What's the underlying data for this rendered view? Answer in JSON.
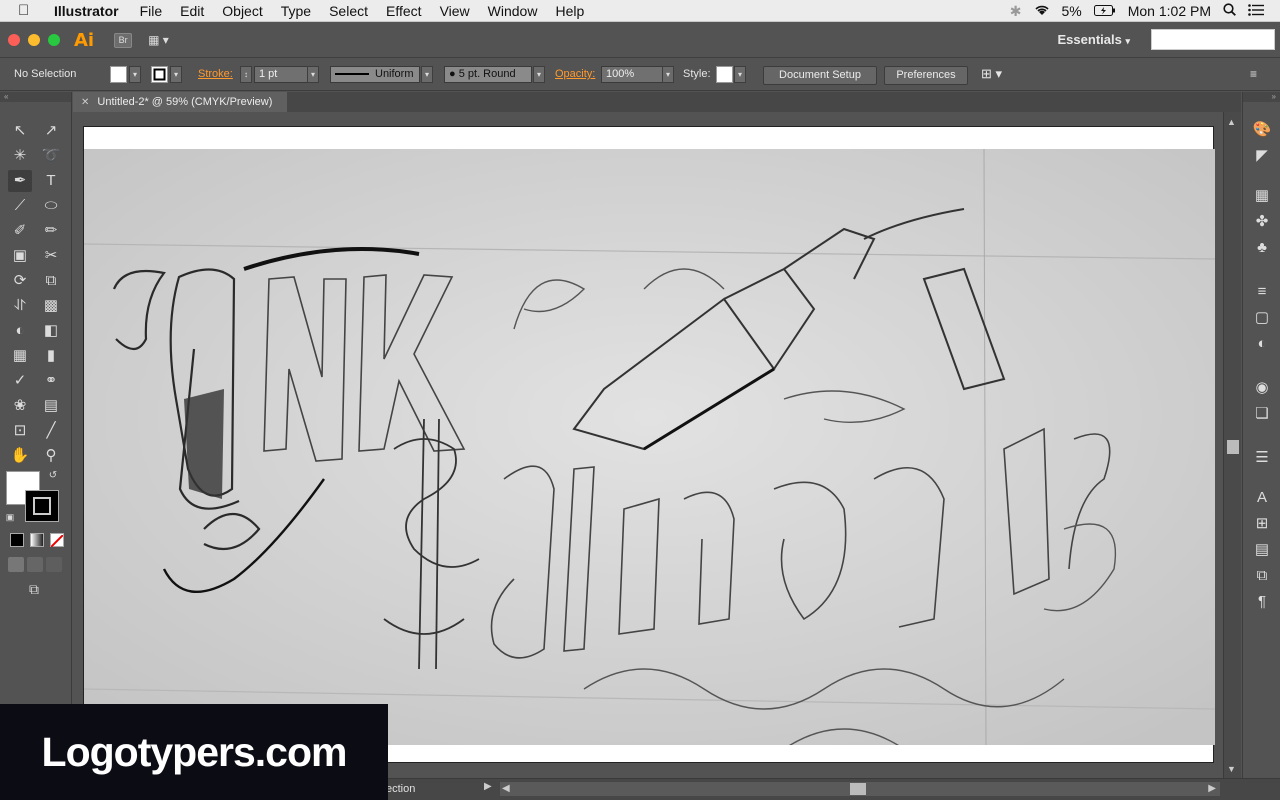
{
  "menubar": {
    "app_name": "Illustrator",
    "items": [
      "File",
      "Edit",
      "Object",
      "Type",
      "Select",
      "Effect",
      "View",
      "Window",
      "Help"
    ],
    "battery": "5%",
    "clock": "Mon 1:02 PM"
  },
  "appbar": {
    "logo": "Ai",
    "bridge_label": "Br",
    "workspace": "Essentials"
  },
  "control": {
    "selection_status": "No Selection",
    "stroke_label": "Stroke:",
    "stroke_weight": "1 pt",
    "profile": "Uniform",
    "brush": "5 pt. Round",
    "opacity_label": "Opacity:",
    "opacity_value": "100%",
    "style_label": "Style:",
    "document_setup": "Document Setup",
    "preferences": "Preferences"
  },
  "document": {
    "tab_title": "Untitled-2* @ 59% (CMYK/Preview)"
  },
  "status": {
    "text": "ection"
  },
  "watermark": {
    "text": "Logotypers.com"
  },
  "colors": {
    "accent": "#ff9a00",
    "ui_bg": "#535353"
  }
}
